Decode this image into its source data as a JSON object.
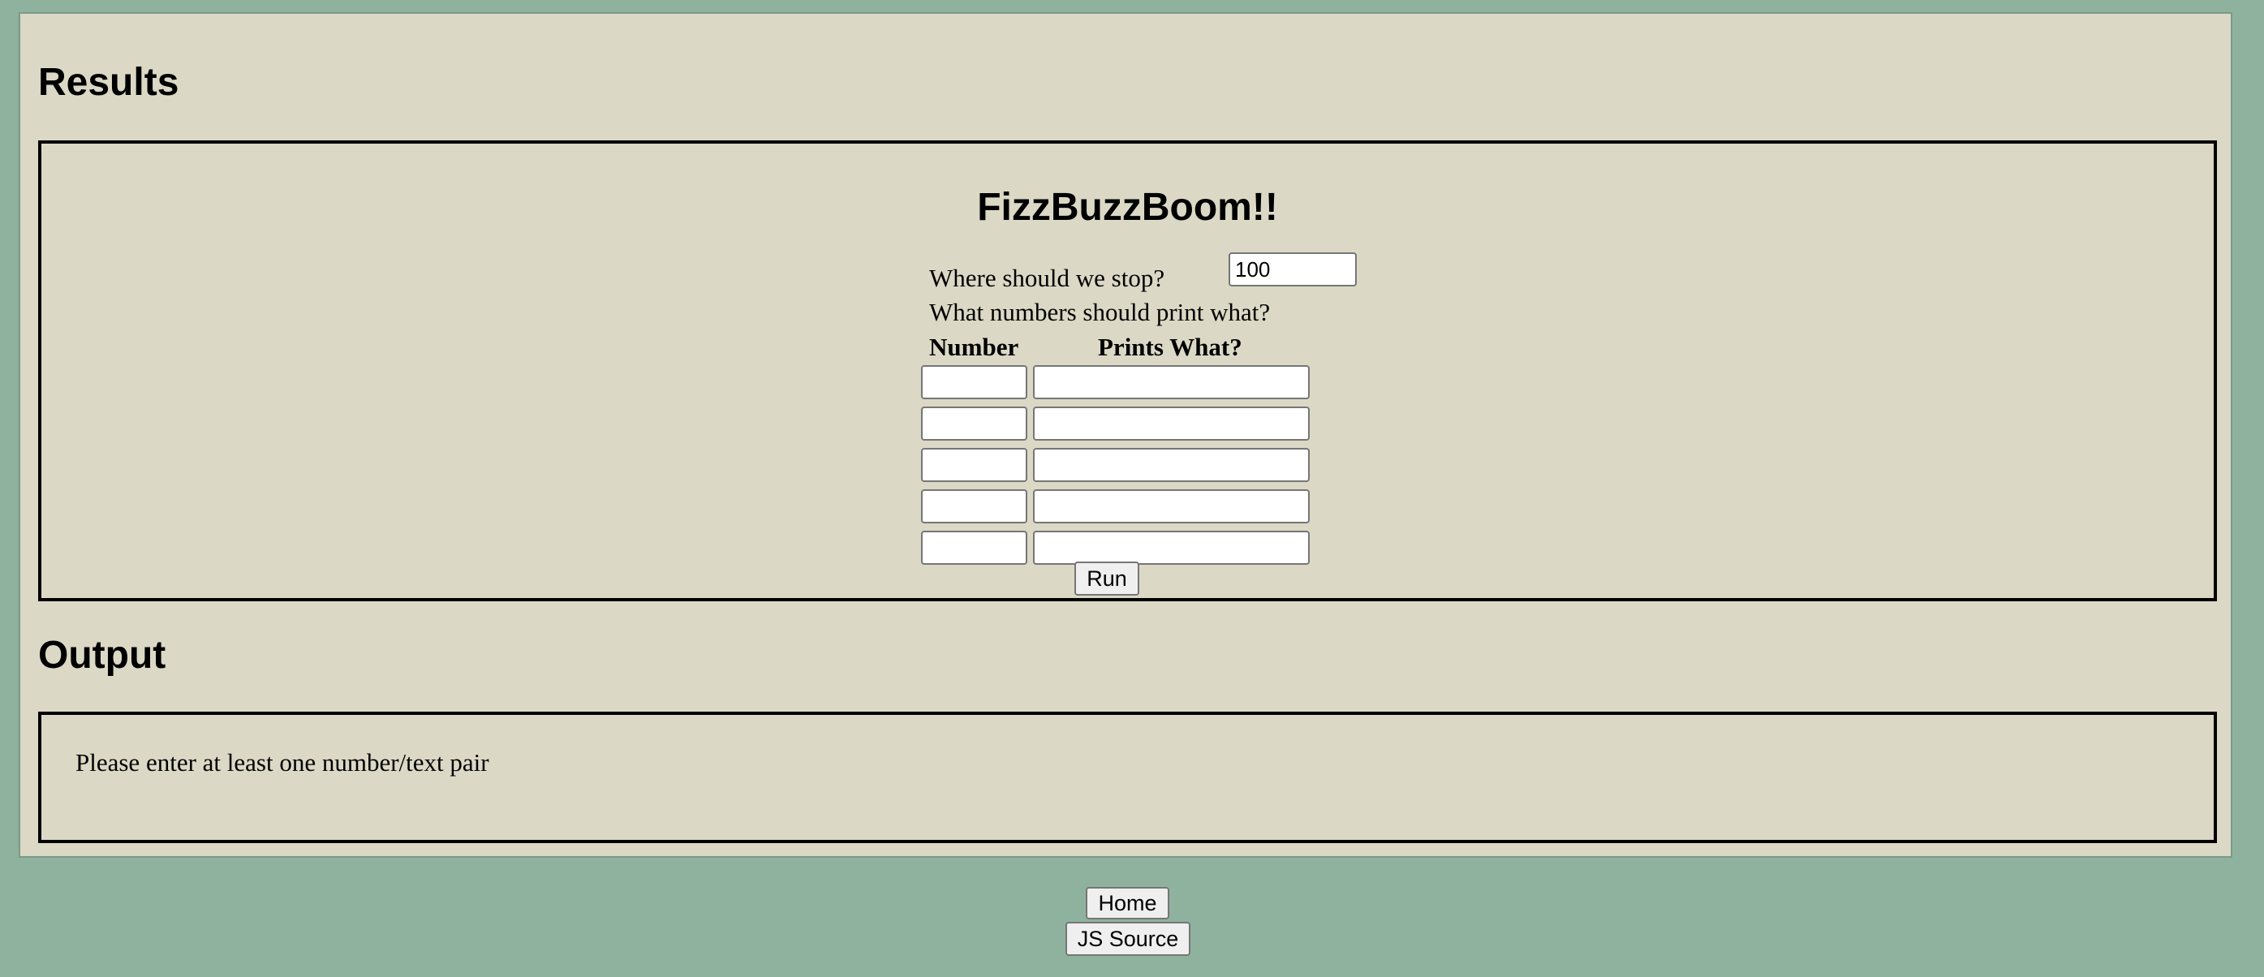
{
  "results": {
    "heading": "Results",
    "app_title": "FizzBuzzBoom!!",
    "stop_label": "Where should we stop?",
    "stop_value": "100",
    "numbers_label": "What numbers should print what?",
    "column_number": "Number",
    "column_prints": "Prints What?",
    "rows": [
      {
        "number": "",
        "text": ""
      },
      {
        "number": "",
        "text": ""
      },
      {
        "number": "",
        "text": ""
      },
      {
        "number": "",
        "text": ""
      },
      {
        "number": "",
        "text": ""
      }
    ],
    "run_label": "Run"
  },
  "output": {
    "heading": "Output",
    "message": "Please enter at least one number/text pair"
  },
  "footer": {
    "home_label": "Home",
    "source_label": "JS Source"
  },
  "colors": {
    "page_background": "#8fb29e",
    "panel_background": "#dbd9c6"
  }
}
